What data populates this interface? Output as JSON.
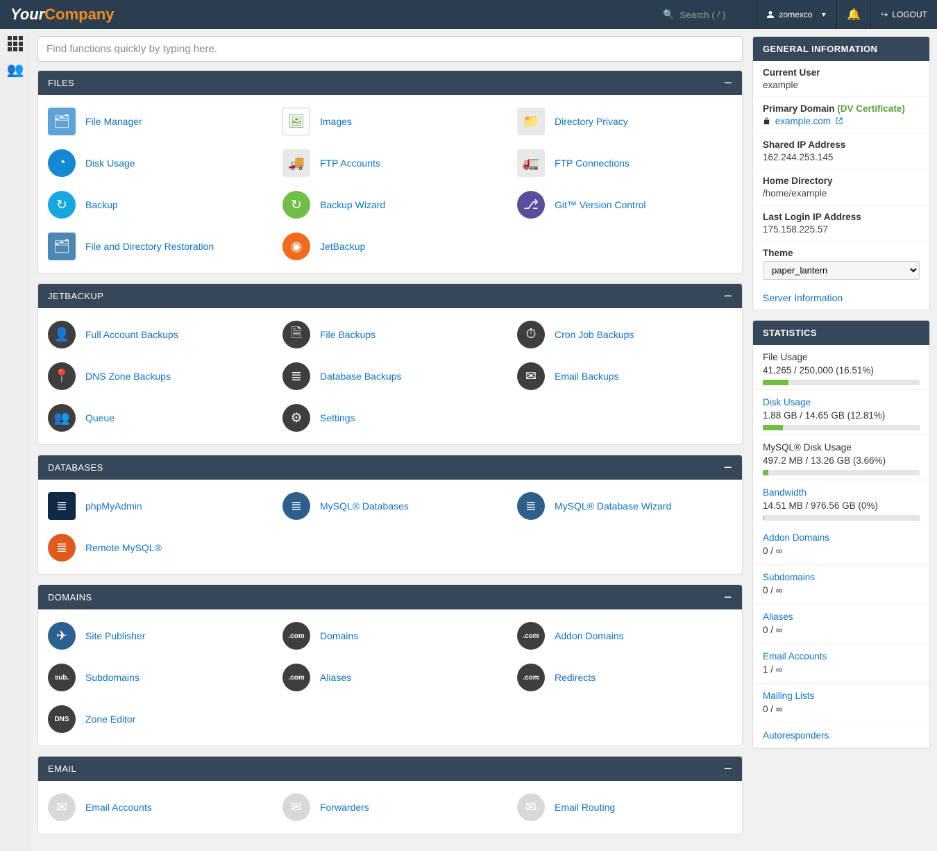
{
  "header": {
    "logo_part1": "Your",
    "logo_part2": "Company",
    "search_placeholder": "Search ( / )",
    "user": "zomexco",
    "logout": "LOGOUT"
  },
  "bigsearch_placeholder": "Find functions quickly by typing here.",
  "groups": [
    {
      "title": "FILES",
      "apps": [
        {
          "label": "File Manager",
          "color": "#5fa2d6",
          "shape": "sq",
          "glyph": "🗂"
        },
        {
          "label": "Images",
          "color": "#ffffff",
          "shape": "sq-border",
          "glyph": "🖼"
        },
        {
          "label": "Directory Privacy",
          "color": "#e8e8e8",
          "shape": "sq",
          "glyph": "📁"
        },
        {
          "label": "Disk Usage",
          "color": "#1688d3",
          "glyph": "◔"
        },
        {
          "label": "FTP Accounts",
          "color": "#e8e8e8",
          "shape": "sq",
          "glyph": "🚚"
        },
        {
          "label": "FTP Connections",
          "color": "#e8e8e8",
          "shape": "sq",
          "glyph": "🚛"
        },
        {
          "label": "Backup",
          "color": "#17a7e0",
          "glyph": "↻"
        },
        {
          "label": "Backup Wizard",
          "color": "#6fbf44",
          "glyph": "↻"
        },
        {
          "label": "Git™ Version Control",
          "color": "#5b4d9e",
          "glyph": "⎇"
        },
        {
          "label": "File and Directory Restoration",
          "color": "#4d88b5",
          "shape": "sq",
          "glyph": "🗂"
        },
        {
          "label": "JetBackup",
          "color": "#f26a1b",
          "glyph": "◉"
        }
      ]
    },
    {
      "title": "JETBACKUP",
      "apps": [
        {
          "label": "Full Account Backups",
          "color": "#3e3e3e",
          "glyph": "👤"
        },
        {
          "label": "File Backups",
          "color": "#3e3e3e",
          "glyph": "🗎"
        },
        {
          "label": "Cron Job Backups",
          "color": "#3e3e3e",
          "glyph": "⏱"
        },
        {
          "label": "DNS Zone Backups",
          "color": "#3e3e3e",
          "glyph": "📍"
        },
        {
          "label": "Database Backups",
          "color": "#3e3e3e",
          "glyph": "≣"
        },
        {
          "label": "Email Backups",
          "color": "#3e3e3e",
          "glyph": "✉"
        },
        {
          "label": "Queue",
          "color": "#3e3e3e",
          "glyph": "👥"
        },
        {
          "label": "Settings",
          "color": "#3e3e3e",
          "glyph": "⚙"
        }
      ]
    },
    {
      "title": "DATABASES",
      "apps": [
        {
          "label": "phpMyAdmin",
          "color": "#0e2a47",
          "shape": "sq",
          "glyph": "≣"
        },
        {
          "label": "MySQL® Databases",
          "color": "#2e5f8a",
          "glyph": "≣"
        },
        {
          "label": "MySQL® Database Wizard",
          "color": "#2e5f8a",
          "glyph": "≣"
        },
        {
          "label": "Remote MySQL®",
          "color": "#e05a1b",
          "glyph": "≣"
        }
      ]
    },
    {
      "title": "DOMAINS",
      "apps": [
        {
          "label": "Site Publisher",
          "color": "#2a5f90",
          "glyph": "✈"
        },
        {
          "label": "Domains",
          "color": "#3e3e3e",
          "glyph": ".com"
        },
        {
          "label": "Addon Domains",
          "color": "#3e3e3e",
          "glyph": ".com"
        },
        {
          "label": "Subdomains",
          "color": "#3e3e3e",
          "glyph": "sub."
        },
        {
          "label": "Aliases",
          "color": "#3e3e3e",
          "glyph": ".com"
        },
        {
          "label": "Redirects",
          "color": "#3e3e3e",
          "glyph": ".com"
        },
        {
          "label": "Zone Editor",
          "color": "#3e3e3e",
          "glyph": "DNS"
        }
      ]
    },
    {
      "title": "EMAIL",
      "apps": [
        {
          "label": "Email Accounts",
          "color": "#d8d8d8",
          "shape": "env",
          "glyph": "✉"
        },
        {
          "label": "Forwarders",
          "color": "#d8d8d8",
          "shape": "env",
          "glyph": "✉"
        },
        {
          "label": "Email Routing",
          "color": "#d8d8d8",
          "shape": "env",
          "glyph": "✉"
        }
      ]
    }
  ],
  "general_info": {
    "title": "GENERAL INFORMATION",
    "rows": [
      {
        "k": "Current User",
        "v": "example"
      },
      {
        "k": "Primary Domain",
        "dv": "(DV Certificate)",
        "link": "example.com",
        "lock": true
      },
      {
        "k": "Shared IP Address",
        "v": "162.244.253.145"
      },
      {
        "k": "Home Directory",
        "v": "/home/example"
      },
      {
        "k": "Last Login IP Address",
        "v": "175.158.225.57"
      },
      {
        "k": "Theme",
        "select": "paper_lantern"
      }
    ],
    "server_info": "Server Information"
  },
  "stats": {
    "title": "STATISTICS",
    "items": [
      {
        "title": "File Usage",
        "value": "41,265 / 250,000   (16.51%)",
        "pct": 16.51,
        "link": false
      },
      {
        "title": "Disk Usage",
        "value": "1.88 GB / 14.65 GB   (12.81%)",
        "pct": 12.81,
        "link": true
      },
      {
        "title": "MySQL® Disk Usage",
        "value": "497.2 MB / 13.26 GB   (3.66%)",
        "pct": 3.66,
        "link": false
      },
      {
        "title": "Bandwidth",
        "value": "14.51 MB / 976.56 GB   (0%)",
        "pct": 0.3,
        "link": true
      },
      {
        "title": "Addon Domains",
        "value": "0 / ∞",
        "link": true
      },
      {
        "title": "Subdomains",
        "value": "0 / ∞",
        "link": true
      },
      {
        "title": "Aliases",
        "value": "0 / ∞",
        "link": true
      },
      {
        "title": "Email Accounts",
        "value": "1 / ∞",
        "link": true
      },
      {
        "title": "Mailing Lists",
        "value": "0 / ∞",
        "link": true
      },
      {
        "title": "Autoresponders",
        "value": "",
        "link": true
      }
    ]
  }
}
